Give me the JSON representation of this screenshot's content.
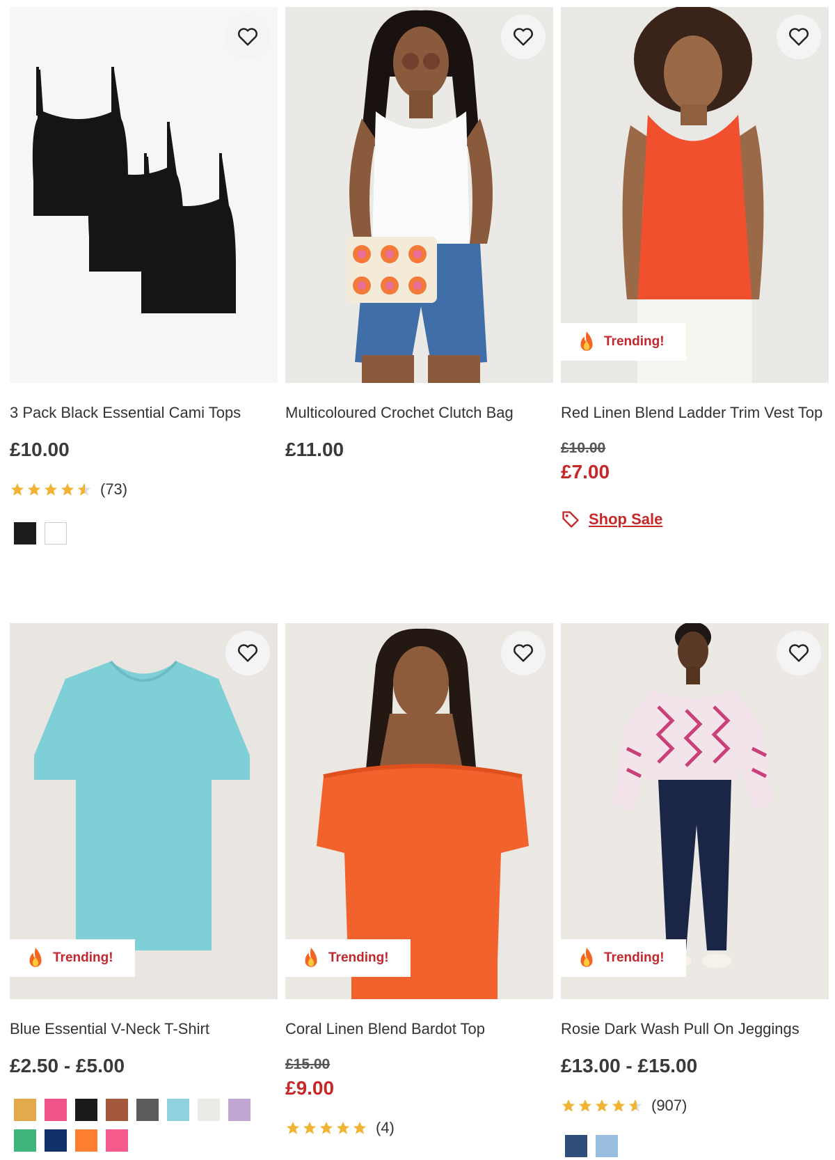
{
  "products": [
    {
      "title": "3 Pack Black Essential Cami Tops",
      "price": "£10.00",
      "rating_count": "(73)",
      "rating": 4.5,
      "swatches": [
        "#1c1c1c",
        "#ffffff"
      ]
    },
    {
      "title": "Multicoloured Crochet Clutch Bag",
      "price": "£11.00"
    },
    {
      "title": "Red Linen Blend Ladder Trim Vest Top",
      "was_price": "£10.00",
      "now_price": "£7.00",
      "badge": "Trending!",
      "shop_sale": "Shop Sale"
    },
    {
      "title": "Blue Essential V-Neck T-Shirt",
      "price": "£2.50 - £5.00",
      "badge": "Trending!",
      "swatches": [
        "#e3a94a",
        "#f0538a",
        "#1b1b1b",
        "#a3583a",
        "#5c5c5c",
        "#8fd1dc",
        "#ebebe6",
        "#c1a6d3",
        "#3fb57e",
        "#10306a",
        "#ff7f32",
        "#f75b8b"
      ]
    },
    {
      "title": "Coral Linen Blend Bardot Top",
      "was_price": "£15.00",
      "now_price": "£9.00",
      "badge": "Trending!",
      "rating_count": "(4)",
      "rating": 5
    },
    {
      "title": "Rosie Dark Wash Pull On Jeggings",
      "price": "£13.00 - £15.00",
      "badge": "Trending!",
      "rating_count": "(907)",
      "rating": 4.5,
      "swatches": [
        "#2f4d7a",
        "#99bedf"
      ]
    }
  ],
  "colors": {
    "sale_red": "#c62828",
    "star_gold": "#f0b432",
    "badge_text": "#c1272d"
  },
  "icons": {
    "wishlist": "heart-outline-icon",
    "trending": "fire-icon",
    "sale": "price-tag-icon",
    "rating": "star-icon"
  }
}
